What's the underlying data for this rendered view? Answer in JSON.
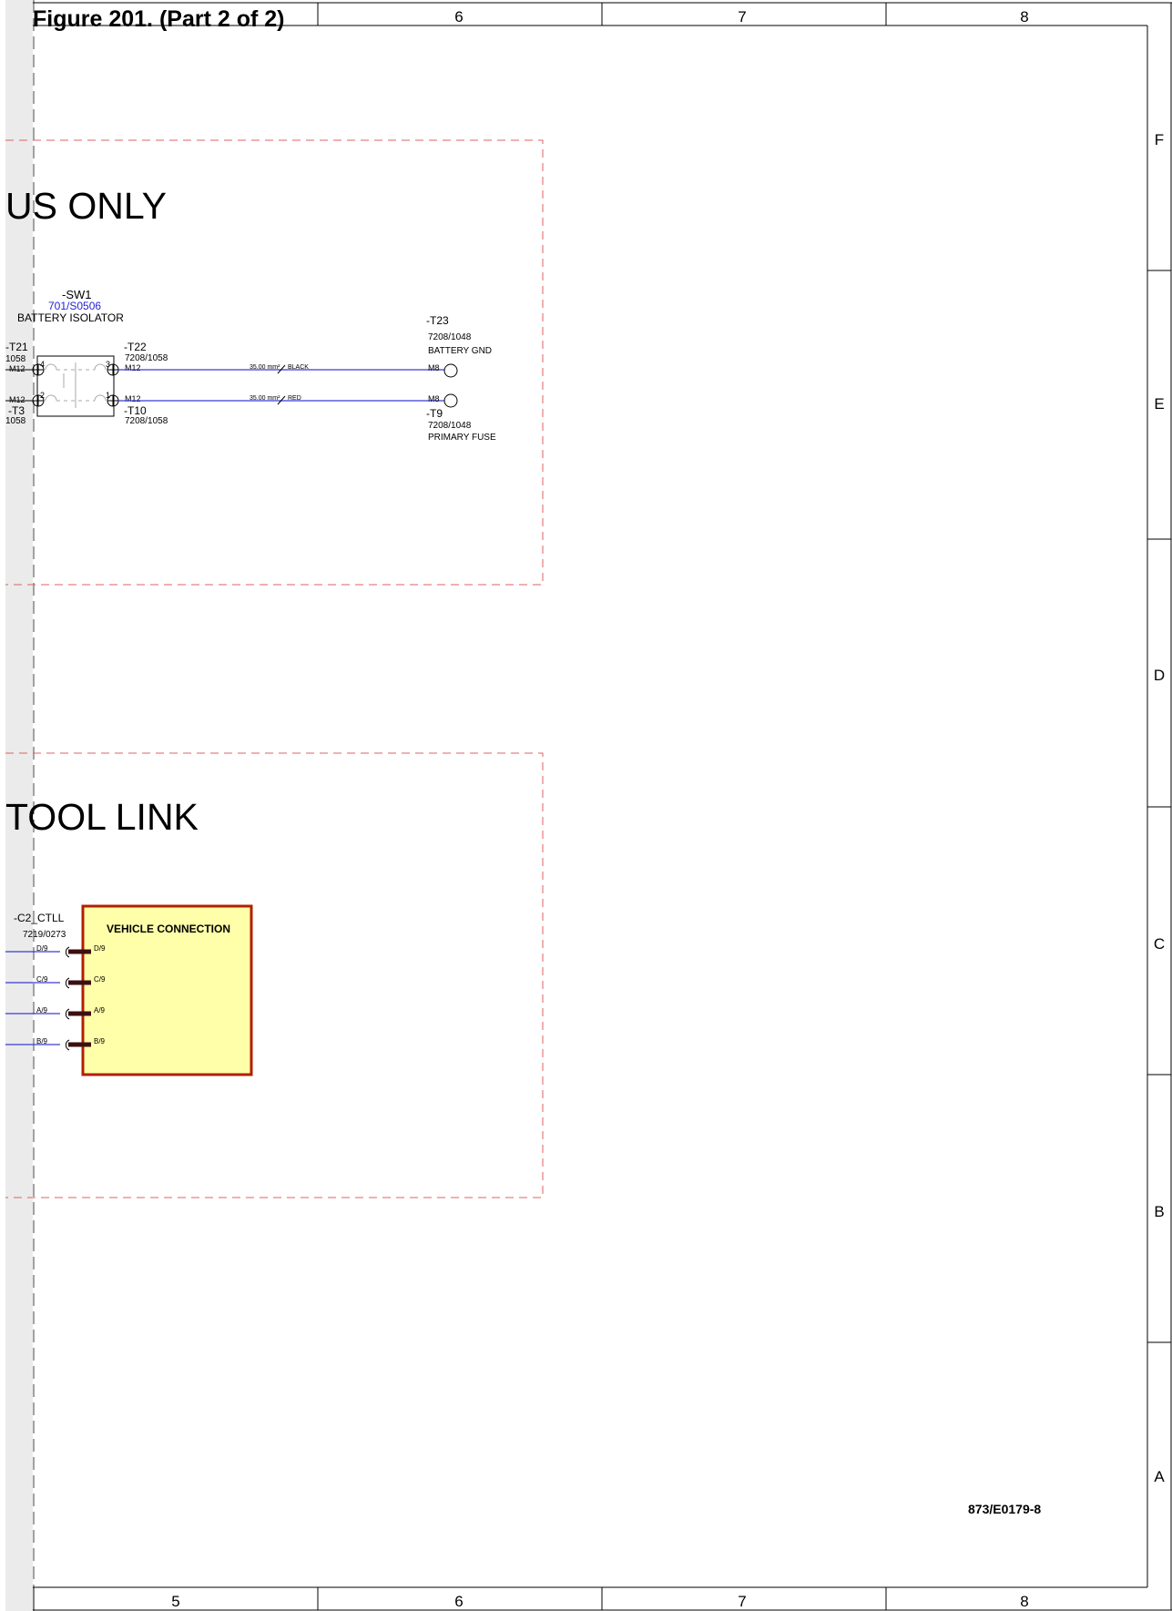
{
  "figure_title": "Figure 201. (Part 2 of 2)",
  "column_labels_top": [
    "6",
    "7",
    "8"
  ],
  "column_labels_bottom": [
    "5",
    "6",
    "7",
    "8"
  ],
  "row_labels": [
    "F",
    "E",
    "D",
    "C",
    "B",
    "A"
  ],
  "section_1": {
    "title": "US ONLY",
    "switch": {
      "tag": "-SW1",
      "ref": "701/S0506",
      "desc": "BATTERY ISOLATOR",
      "pin_tl": "4",
      "pin_tr": "3",
      "pin_bl": "2",
      "pin_br": "1"
    },
    "left_terms": {
      "t21_tag": "-T21",
      "t21_ref": "1058",
      "t21_bolt": "M12",
      "t3_bolt": "M12",
      "t3_tag": "-T3",
      "t3_ref": "1058"
    },
    "t22": {
      "tag": "-T22",
      "ref": "7208/1058",
      "bolt": "M12"
    },
    "t10": {
      "tag": "-T10",
      "ref": "7208/1058",
      "bolt": "M12"
    },
    "wire_black": {
      "size": "35.00 mm²",
      "color_label": "BLACK"
    },
    "wire_red": {
      "size": "35.00 mm²",
      "color_label": "RED"
    },
    "t23": {
      "tag": "-T23",
      "ref": "7208/1048",
      "desc": "BATTERY GND",
      "bolt": "M8"
    },
    "t9": {
      "tag": "-T9",
      "ref": "7208/1048",
      "desc": "PRIMARY FUSE",
      "bolt": "M8"
    }
  },
  "section_2": {
    "title": "TOOL LINK",
    "connector": {
      "tag": "-C2_CTLL",
      "ref": "7219/0273"
    },
    "box_title": "VEHICLE CONNECTION",
    "pins": [
      {
        "left": "D/9",
        "right": "D/9"
      },
      {
        "left": "C/9",
        "right": "C/9"
      },
      {
        "left": "A/9",
        "right": "A/9"
      },
      {
        "left": "B/9",
        "right": "B/9"
      }
    ]
  },
  "drawing_number": "873/E0179-8",
  "colors": {
    "wire": "#3a3ad6",
    "section_border": "#e06060",
    "box_fill": "#ffffaa",
    "box_border": "#b02000",
    "ref_text": "#2222dd",
    "margin_strip": "#ebebeb"
  }
}
